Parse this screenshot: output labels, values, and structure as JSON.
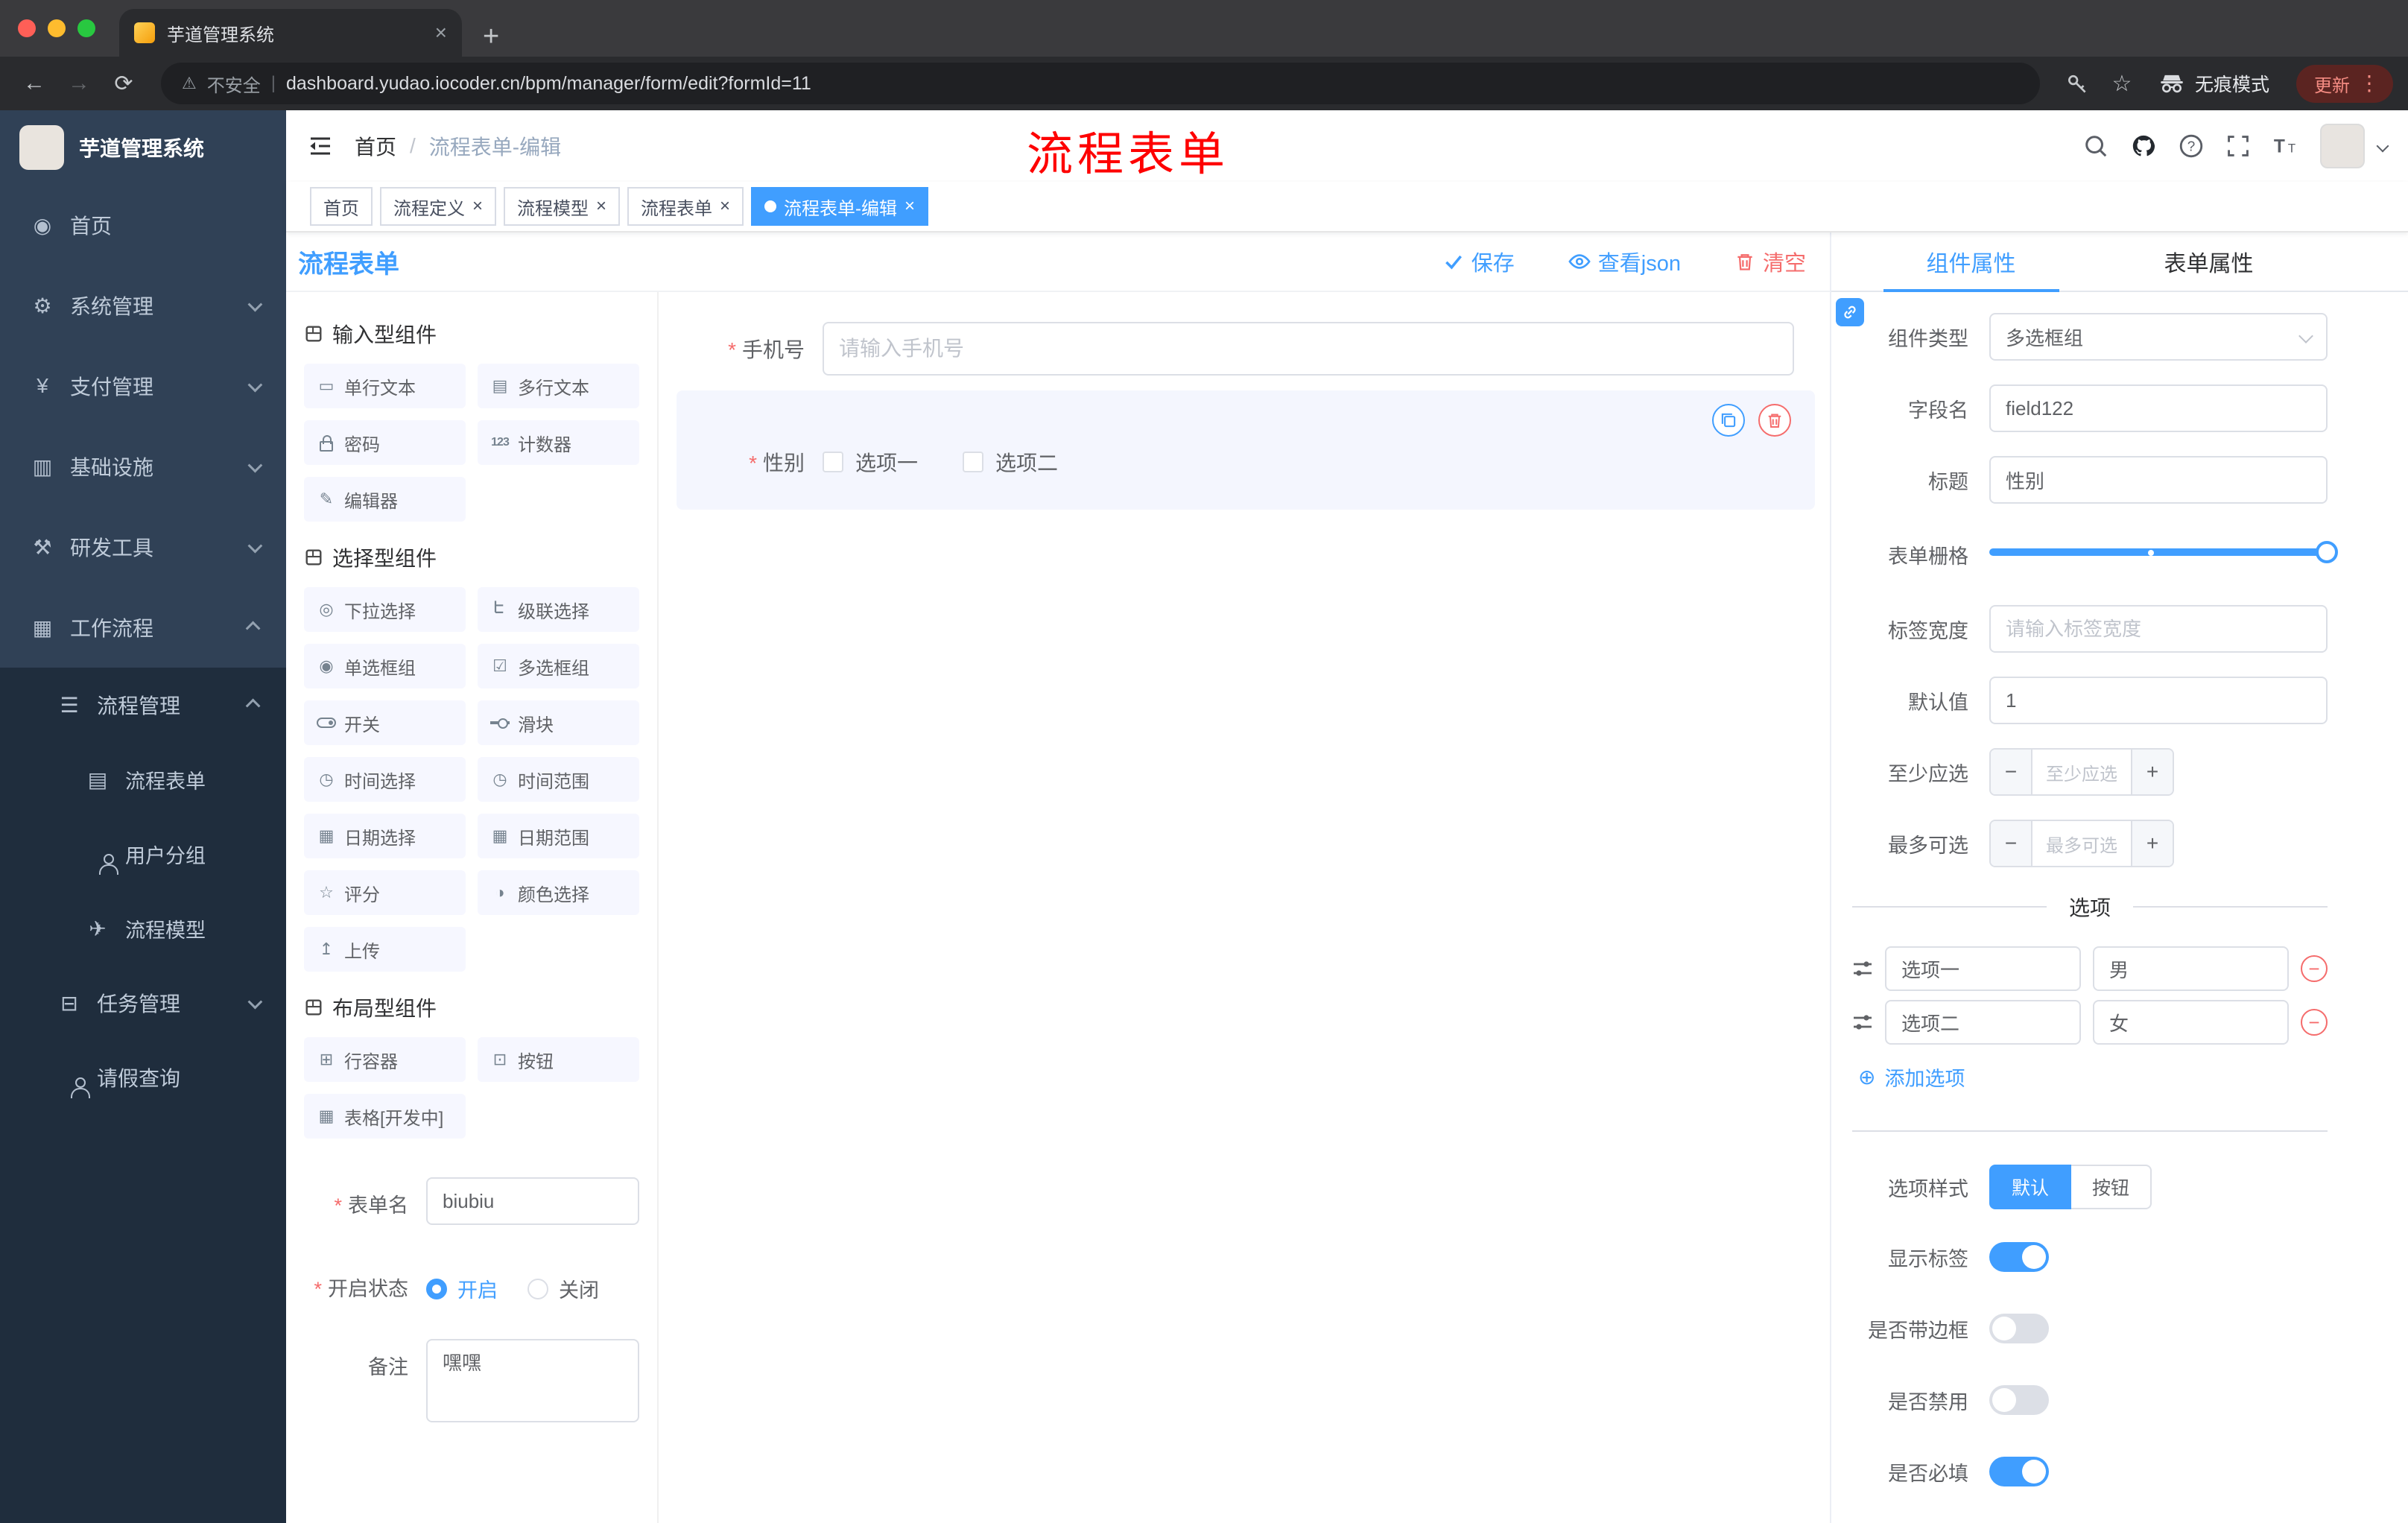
{
  "chrome": {
    "tab_title": "芋道管理系统",
    "security_label": "不安全",
    "url": "dashboard.yudao.iocoder.cn/bpm/manager/form/edit?formId=11",
    "incognito_label": "无痕模式",
    "update_label": "更新"
  },
  "annotation": {
    "text": "流程表单",
    "color": "#fe0000"
  },
  "sidebar": {
    "logo_title": "芋道管理系统",
    "menu": [
      {
        "label": "首页",
        "icon": "dashboard-icon"
      },
      {
        "label": "系统管理",
        "icon": "gear-icon"
      },
      {
        "label": "支付管理",
        "icon": "yen-icon"
      },
      {
        "label": "基础设施",
        "icon": "infrastructure-icon"
      },
      {
        "label": "研发工具",
        "icon": "tools-icon"
      },
      {
        "label": "工作流程",
        "icon": "workflow-icon"
      },
      {
        "label": "流程管理",
        "icon": "process-management-icon"
      },
      {
        "label": "流程表单",
        "icon": "form-icon"
      },
      {
        "label": "用户分组",
        "icon": "user-group-icon"
      },
      {
        "label": "流程模型",
        "icon": "model-icon"
      },
      {
        "label": "任务管理",
        "icon": "task-icon"
      },
      {
        "label": "请假查询",
        "icon": "person-icon"
      }
    ]
  },
  "header": {
    "breadcrumb_home": "首页",
    "breadcrumb_current": "流程表单-编辑",
    "right_icons": [
      "search-icon",
      "github-icon",
      "help-icon",
      "fullscreen-icon",
      "font-size-icon",
      "avatar",
      "chevron-down-icon"
    ]
  },
  "tagbar": {
    "tags": [
      {
        "label": "首页",
        "closable": false,
        "active": false
      },
      {
        "label": "流程定义",
        "closable": true,
        "active": false
      },
      {
        "label": "流程模型",
        "closable": true,
        "active": false
      },
      {
        "label": "流程表单",
        "closable": true,
        "active": false
      },
      {
        "label": "流程表单-编辑",
        "closable": true,
        "active": true
      }
    ]
  },
  "designer": {
    "title": "流程表单",
    "save_label": "保存",
    "view_json_label": "查看json",
    "clear_label": "清空",
    "palette": {
      "section1_title": "输入型组件",
      "section2_title": "选择型组件",
      "section3_title": "布局型组件",
      "input_items": [
        {
          "label": "单行文本",
          "icon": "single-line-text-icon"
        },
        {
          "label": "多行文本",
          "icon": "multi-line-text-icon"
        },
        {
          "label": "密码",
          "icon": "lock-icon"
        },
        {
          "label": "计数器",
          "icon": "counter-icon"
        },
        {
          "label": "编辑器",
          "icon": "editor-icon"
        }
      ],
      "select_items": [
        {
          "label": "下拉选择",
          "icon": "dropdown-icon"
        },
        {
          "label": "级联选择",
          "icon": "cascade-icon"
        },
        {
          "label": "单选框组",
          "icon": "radio-group-icon"
        },
        {
          "label": "多选框组",
          "icon": "checkbox-group-icon"
        },
        {
          "label": "开关",
          "icon": "switch-icon"
        },
        {
          "label": "滑块",
          "icon": "slider-icon"
        },
        {
          "label": "时间选择",
          "icon": "time-picker-icon"
        },
        {
          "label": "时间范围",
          "icon": "time-range-icon"
        },
        {
          "label": "日期选择",
          "icon": "date-picker-icon"
        },
        {
          "label": "日期范围",
          "icon": "date-range-icon"
        },
        {
          "label": "评分",
          "icon": "rating-icon"
        },
        {
          "label": "颜色选择",
          "icon": "color-picker-icon"
        },
        {
          "label": "上传",
          "icon": "upload-icon"
        }
      ],
      "layout_items": [
        {
          "label": "行容器",
          "icon": "row-container-icon"
        },
        {
          "label": "按钮",
          "icon": "button-icon"
        },
        {
          "label": "表格[开发中]",
          "icon": "table-icon"
        }
      ]
    },
    "meta": {
      "form_name_label": "表单名",
      "form_name_value": "biubiu",
      "status_label": "开启状态",
      "status_on": "开启",
      "status_off": "关闭",
      "remark_label": "备注",
      "remark_value": "嘿嘿"
    },
    "canvas": {
      "phone_label": "手机号",
      "phone_placeholder": "请输入手机号",
      "gender_label": "性别",
      "gender_option1": "选项一",
      "gender_option2": "选项二"
    }
  },
  "props": {
    "tab_component": "组件属性",
    "tab_form": "表单属性",
    "component_type_label": "组件类型",
    "component_type_value": "多选框组",
    "field_name_label": "字段名",
    "field_name_value": "field122",
    "title_label": "标题",
    "title_value": "性别",
    "grid_label": "表单栅格",
    "label_width_label": "标签宽度",
    "label_width_placeholder": "请输入标签宽度",
    "default_label": "默认值",
    "default_value": "1",
    "min_label": "至少应选",
    "min_placeholder": "至少应选",
    "max_label": "最多可选",
    "max_placeholder": "最多可选",
    "options_divider": "选项",
    "options": [
      {
        "label": "选项一",
        "value": "男"
      },
      {
        "label": "选项二",
        "value": "女"
      }
    ],
    "add_option_label": "添加选项",
    "style_label": "选项样式",
    "style_default": "默认",
    "style_button": "按钮",
    "switches": [
      {
        "label": "显示标签",
        "on": true
      },
      {
        "label": "是否带边框",
        "on": false
      },
      {
        "label": "是否禁用",
        "on": false
      },
      {
        "label": "是否必填",
        "on": true
      }
    ]
  },
  "colors": {
    "primary": "#409EFF",
    "danger": "#F56C6C",
    "sidebar_bg": "#304156",
    "submenu_bg": "#1F2D3D",
    "annotation_red": "#FE0000"
  }
}
